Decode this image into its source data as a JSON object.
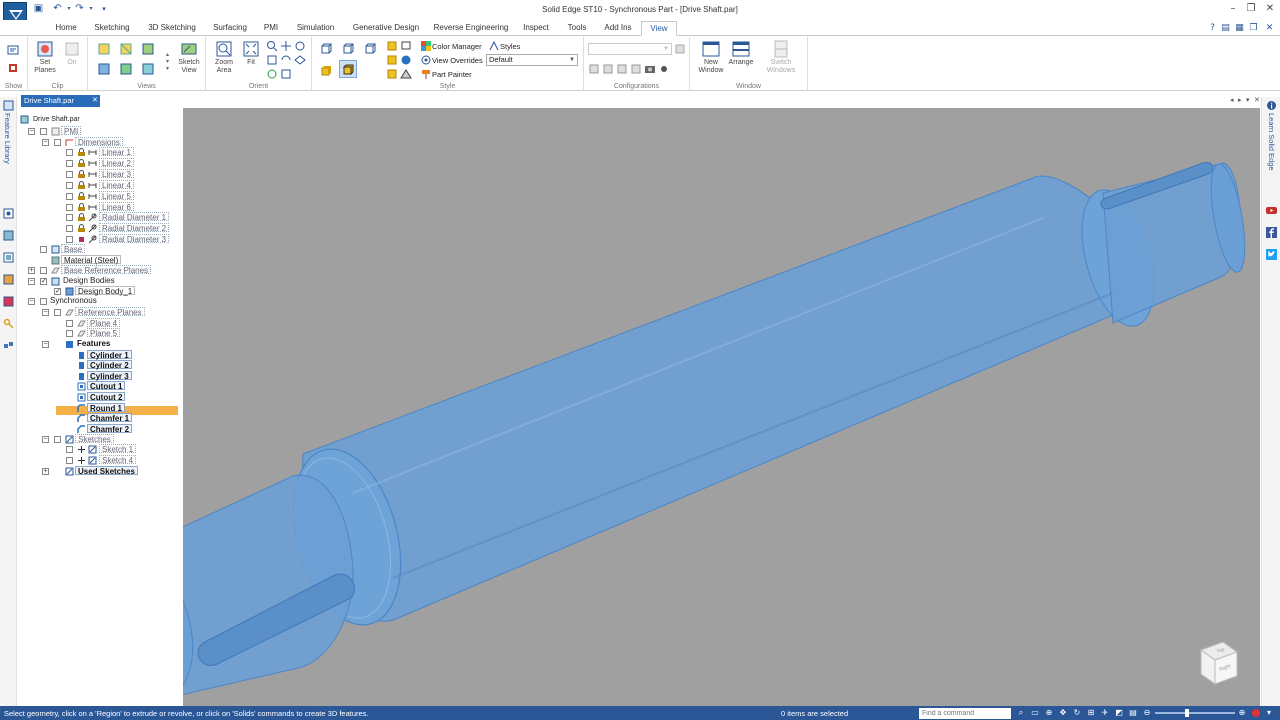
{
  "window": {
    "title": "Solid Edge ST10 - Synchronous Part - [Drive Shaft.par]"
  },
  "ribbon_tabs": [
    "Home",
    "Sketching",
    "3D Sketching",
    "Surfacing",
    "PMI",
    "Simulation",
    "Generative Design",
    "Reverse Engineering",
    "Inspect",
    "Tools",
    "Add Ins",
    "View"
  ],
  "active_tab": "View",
  "ribbon": {
    "show_group": "Show",
    "clip_group": "Clip",
    "set_planes": "Set Planes",
    "on_label": "On",
    "views_group": "Views",
    "sketch_view": "Sketch View",
    "orient_group": "Orient",
    "zoom_area": "Zoom Area",
    "fit": "Fit",
    "style_group": "Style",
    "color_manager": "Color Manager",
    "styles": "Styles",
    "view_overrides": "View Overrides",
    "view_overrides_value": "Default",
    "part_painter": "Part Painter",
    "configurations_group": "Configurations",
    "window_group": "Window",
    "new_window": "New Window",
    "arrange": "Arrange",
    "switch_windows": "Switch Windows"
  },
  "document_tab": "Drive Shaft.par",
  "left_strip_label": "Feature Library",
  "right_strip_label": "Learn Solid Edge",
  "tree": {
    "root": "Drive Shaft.par",
    "pmi": "PMI",
    "dimensions": "Dimensions",
    "dimension_items": [
      "Linear 1",
      "Linear 2",
      "Linear 3",
      "Linear 4",
      "Linear 5",
      "Linear 6",
      "Radial Diameter 1",
      "Radial Diameter 2",
      "Radial Diameter 3"
    ],
    "base": "Base",
    "material": "Material (Steel)",
    "base_reference_planes": "Base Reference Planes",
    "design_bodies": "Design Bodies",
    "design_body": "Design Body_1",
    "synchronous": "Synchronous",
    "reference_planes": "Reference Planes",
    "planes": [
      "Plane 4",
      "Plane 5"
    ],
    "features": "Features",
    "feature_items": [
      "Cylinder 1",
      "Cylinder 2",
      "Cylinder 3",
      "Cutout 1",
      "Cutout 2",
      "Round 1",
      "Chamfer 1",
      "Chamfer 2"
    ],
    "sketches": "Sketches",
    "sketch_items": [
      "Sketch 1",
      "Sketch 4"
    ],
    "used_sketches": "Used Sketches"
  },
  "view_cube": {
    "top": "Top",
    "right": "Right"
  },
  "status": {
    "message": "Select geometry, click on a 'Region' to extrude or revolve, or click on 'Solids' commands to create 3D features.",
    "selection": "0 items are selected",
    "find_placeholder": "Find a command"
  },
  "colors": {
    "status_bar": "#2b5797",
    "viewport_bg": "#a0a0a0",
    "shaft_fill": "#6b9ed4",
    "shaft_edge": "#4c86c6",
    "sync_highlight": "#f5b04a",
    "doc_tab": "#2a6cb8"
  }
}
